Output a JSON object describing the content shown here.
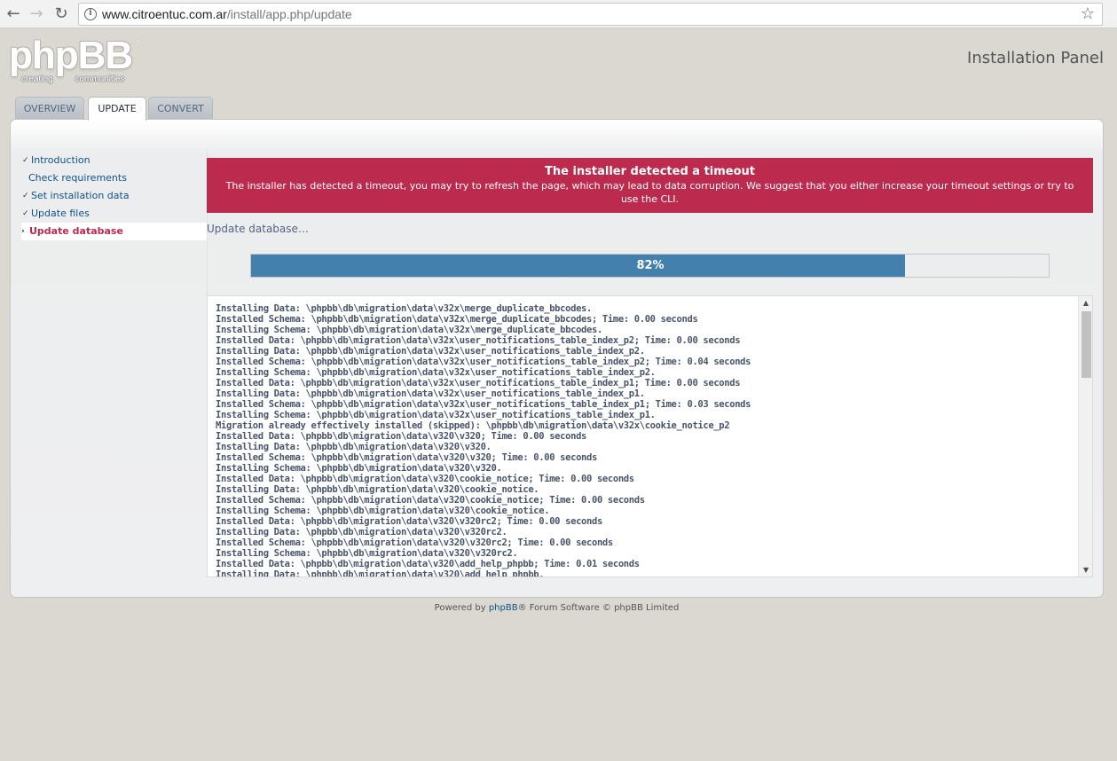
{
  "browser": {
    "url_host": "www.citroentuc.com.ar",
    "url_path": "/install/app.php/update"
  },
  "header": {
    "logo_text": "phpBB",
    "logo_tagline": "creating communities",
    "panel_title": "Installation Panel"
  },
  "tabs": [
    {
      "label": "OVERVIEW",
      "active": false
    },
    {
      "label": "UPDATE",
      "active": true
    },
    {
      "label": "CONVERT",
      "active": false
    }
  ],
  "sidebar": {
    "items": [
      {
        "label": "Introduction"
      },
      {
        "label": "Check requirements"
      },
      {
        "label": "Set installation data"
      },
      {
        "label": "Update files"
      },
      {
        "label": "Update database",
        "active": true
      }
    ]
  },
  "error": {
    "title": "The installer detected a timeout",
    "message": "The installer has detected a timeout, you may try to refresh the page, which may lead to data corruption. We suggest that you either increase your timeout settings or try to use the CLI."
  },
  "status": "Update database…",
  "progress": {
    "percent": 82,
    "label": "82%"
  },
  "log": [
    "Installing Data: \\phpbb\\db\\migration\\data\\v32x\\merge_duplicate_bbcodes.",
    "Installed Schema: \\phpbb\\db\\migration\\data\\v32x\\merge_duplicate_bbcodes; Time: 0.00 seconds",
    "Installing Schema: \\phpbb\\db\\migration\\data\\v32x\\merge_duplicate_bbcodes.",
    "Installed Data: \\phpbb\\db\\migration\\data\\v32x\\user_notifications_table_index_p2; Time: 0.00 seconds",
    "Installing Data: \\phpbb\\db\\migration\\data\\v32x\\user_notifications_table_index_p2.",
    "Installed Schema: \\phpbb\\db\\migration\\data\\v32x\\user_notifications_table_index_p2; Time: 0.04 seconds",
    "Installing Schema: \\phpbb\\db\\migration\\data\\v32x\\user_notifications_table_index_p2.",
    "Installed Data: \\phpbb\\db\\migration\\data\\v32x\\user_notifications_table_index_p1; Time: 0.00 seconds",
    "Installing Data: \\phpbb\\db\\migration\\data\\v32x\\user_notifications_table_index_p1.",
    "Installed Schema: \\phpbb\\db\\migration\\data\\v32x\\user_notifications_table_index_p1; Time: 0.03 seconds",
    "Installing Schema: \\phpbb\\db\\migration\\data\\v32x\\user_notifications_table_index_p1.",
    "Migration already effectively installed (skipped): \\phpbb\\db\\migration\\data\\v32x\\cookie_notice_p2",
    "Installed Data: \\phpbb\\db\\migration\\data\\v320\\v320; Time: 0.00 seconds",
    "Installing Data: \\phpbb\\db\\migration\\data\\v320\\v320.",
    "Installed Schema: \\phpbb\\db\\migration\\data\\v320\\v320; Time: 0.00 seconds",
    "Installing Schema: \\phpbb\\db\\migration\\data\\v320\\v320.",
    "Installed Data: \\phpbb\\db\\migration\\data\\v320\\cookie_notice; Time: 0.00 seconds",
    "Installing Data: \\phpbb\\db\\migration\\data\\v320\\cookie_notice.",
    "Installed Schema: \\phpbb\\db\\migration\\data\\v320\\cookie_notice; Time: 0.00 seconds",
    "Installing Schema: \\phpbb\\db\\migration\\data\\v320\\cookie_notice.",
    "Installed Data: \\phpbb\\db\\migration\\data\\v320\\v320rc2; Time: 0.00 seconds",
    "Installing Data: \\phpbb\\db\\migration\\data\\v320\\v320rc2.",
    "Installed Schema: \\phpbb\\db\\migration\\data\\v320\\v320rc2; Time: 0.00 seconds",
    "Installing Schema: \\phpbb\\db\\migration\\data\\v320\\v320rc2.",
    "Installed Data: \\phpbb\\db\\migration\\data\\v320\\add_help_phpbb; Time: 0.01 seconds",
    "Installing Data: \\phpbb\\db\\migration\\data\\v320\\add_help_phpbb."
  ],
  "footer": {
    "prefix": "Powered by ",
    "link": "phpBB",
    "suffix": "® Forum Software © phpBB Limited"
  },
  "colors": {
    "error_bg": "#bc2a4d",
    "progress_fill": "#4380ad",
    "link": "#105289",
    "page_bg": "#dbd8d2"
  }
}
